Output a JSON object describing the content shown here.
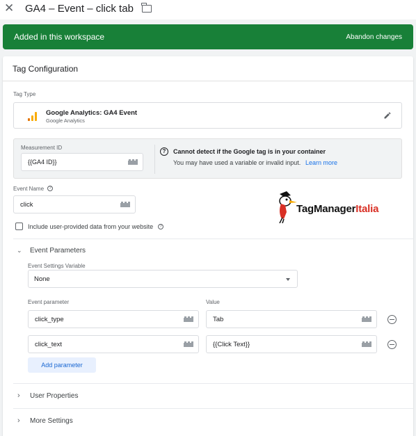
{
  "header": {
    "close_glyph": "✕",
    "title": "GA4 – Event – click tab"
  },
  "banner": {
    "message": "Added in this workspace",
    "action": "Abandon changes",
    "color": "#188038"
  },
  "card": {
    "title": "Tag Configuration",
    "tag_type": {
      "label": "Tag Type",
      "name": "Google Analytics: GA4 Event",
      "vendor": "Google Analytics"
    },
    "measurement": {
      "label": "Measurement ID",
      "value": "{{GA4 ID}}",
      "warning_title": "Cannot detect if the Google tag is in your container",
      "warning_text": "You may have used a variable or invalid input.",
      "learn_more": "Learn more"
    },
    "event_name": {
      "label": "Event Name",
      "value": "click"
    },
    "checkbox_label": "Include user-provided data from your website",
    "event_parameters": {
      "section_title": "Event Parameters",
      "settings_variable_label": "Event Settings Variable",
      "settings_variable_value": "None",
      "col_param": "Event parameter",
      "col_value": "Value",
      "rows": [
        {
          "param": "click_type",
          "value": "Tab"
        },
        {
          "param": "click_text",
          "value": "{{Click Text}}"
        }
      ],
      "add_label": "Add parameter"
    },
    "user_properties": "User Properties",
    "more_settings": "More Settings"
  },
  "logo": {
    "text_main": "TagManager",
    "text_accent": "Italia"
  },
  "colors": {
    "accent_blue": "#1a73e8",
    "ga_orange": "#f9ab00",
    "ga_dark_orange": "#e37400",
    "logo_red": "#d93025"
  }
}
